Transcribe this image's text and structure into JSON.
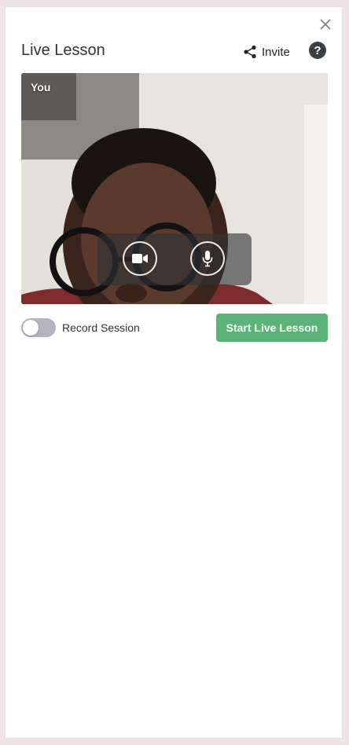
{
  "header": {
    "title": "Live Lesson",
    "invite_label": "Invite",
    "help_label": "?"
  },
  "video": {
    "self_label": "You",
    "camera_icon": "video-camera-icon",
    "mic_icon": "microphone-icon"
  },
  "footer": {
    "record_label": "Record Session",
    "record_enabled": false,
    "start_label": "Start Live Lesson"
  },
  "colors": {
    "accent_green": "#5cb377",
    "toggle_off": "#b4b3bf",
    "background": "#efe3e5"
  }
}
